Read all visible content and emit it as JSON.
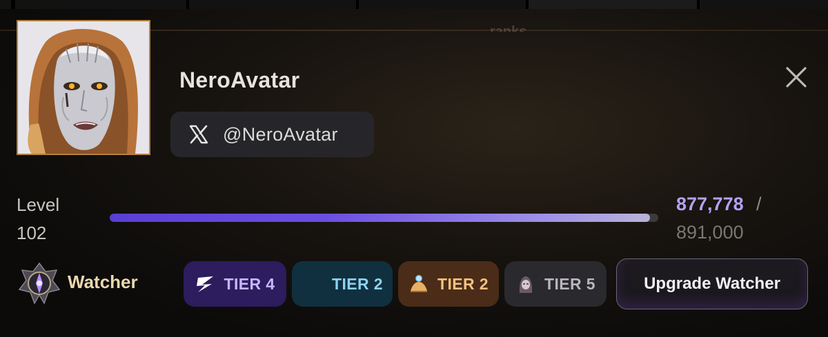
{
  "header": {
    "ghost_title": "ranks"
  },
  "profile": {
    "username": "NeroAvatar",
    "social": {
      "icon": "x-logo-icon",
      "handle": "@NeroAvatar"
    },
    "avatar_icon": "avatar"
  },
  "level": {
    "label": "Level",
    "value": "102",
    "xp_current": "877,778",
    "xp_separator": "/",
    "xp_max": "891,000",
    "progress_fraction": 0.985
  },
  "rank": {
    "icon": "watcher-emblem-icon",
    "label": "Watcher"
  },
  "tiers": [
    {
      "label": "TIER 4",
      "icon": "lightning-z-icon",
      "color": "#c6b8ff"
    },
    {
      "label": "TIER 2",
      "icon": "",
      "color": "#8dd3f2"
    },
    {
      "label": "TIER 2",
      "icon": "coin-pile-icon",
      "color": "#f6c27f"
    },
    {
      "label": "TIER 5",
      "icon": "hooded-figure-icon",
      "color": "#b9b6bd"
    }
  ],
  "actions": {
    "upgrade_label": "Upgrade Watcher",
    "close_icon": "close-icon"
  },
  "colors": {
    "accent_purple": "#6a4fe0",
    "avatar_border": "#b5813f",
    "xp_current": "#b3a2f5"
  }
}
